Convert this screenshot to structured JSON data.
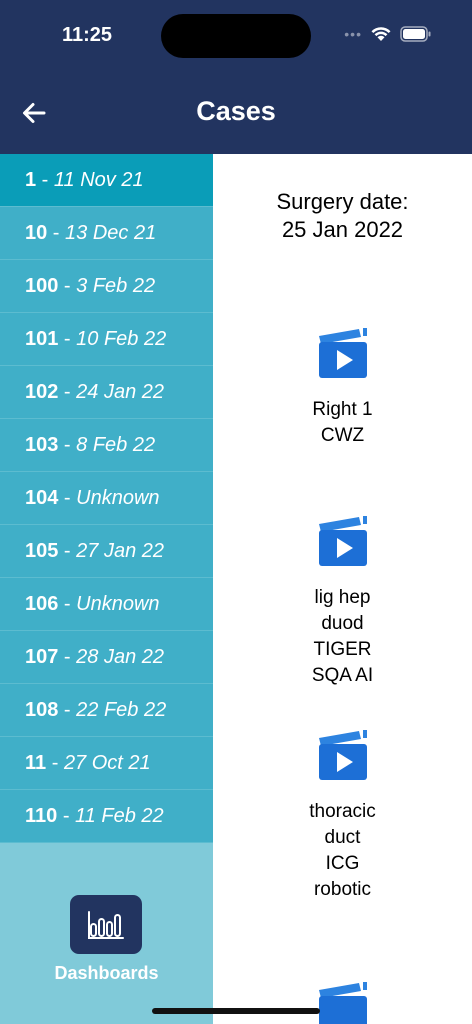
{
  "status_bar": {
    "time": "11:25",
    "signal_dots": "•••"
  },
  "header": {
    "title": "Cases"
  },
  "cases": [
    {
      "num": "1",
      "date": "11 Nov 21",
      "selected": true
    },
    {
      "num": "10",
      "date": "13 Dec 21"
    },
    {
      "num": "100",
      "date": "3 Feb 22"
    },
    {
      "num": "101",
      "date": "10 Feb 22"
    },
    {
      "num": "102",
      "date": "24 Jan 22"
    },
    {
      "num": "103",
      "date": "8 Feb 22"
    },
    {
      "num": "104",
      "date": "Unknown"
    },
    {
      "num": "105",
      "date": "27 Jan 22"
    },
    {
      "num": "106",
      "date": "Unknown"
    },
    {
      "num": "107",
      "date": "28 Jan 22"
    },
    {
      "num": "108",
      "date": "22 Feb 22"
    },
    {
      "num": "11",
      "date": "27 Oct 21"
    },
    {
      "num": "110",
      "date": "11 Feb 22"
    }
  ],
  "dashboard": {
    "label": "Dashboards",
    "icon": "bar-chart-icon"
  },
  "main": {
    "surgery_label": "Surgery date:",
    "surgery_date": "25 Jan 2022",
    "videos": [
      {
        "title": "Right 1\nCWZ",
        "icon": "video-clip-icon"
      },
      {
        "title": "lig hep\nduod\nTIGER\nSQA AI",
        "icon": "video-clip-icon"
      },
      {
        "title": "thoracic\nduct\nICG\nrobotic",
        "icon": "video-clip-icon"
      },
      {
        "title": "",
        "icon": "video-clip-icon"
      }
    ]
  },
  "colors": {
    "header": "#223460",
    "sidebar_item": "#40afc8",
    "sidebar_selected": "#0a9db8",
    "sidebar_bottom": "#80cad9",
    "video_icon_blue": "#1d6fd6"
  }
}
